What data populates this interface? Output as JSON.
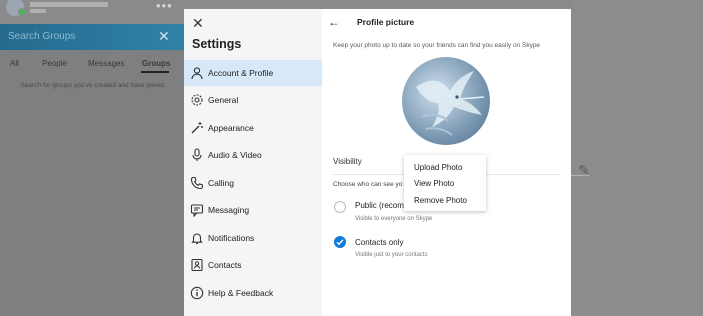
{
  "background": {
    "search_placeholder": "Search Groups",
    "filters": [
      "All",
      "People",
      "Messages",
      "Groups"
    ],
    "groups_hint": "Search for groups you've created and have joined."
  },
  "settings": {
    "title": "Settings",
    "nav_items": [
      {
        "label": "Account & Profile",
        "icon": "user-icon",
        "selected": true
      },
      {
        "label": "General",
        "icon": "gear-icon",
        "selected": false
      },
      {
        "label": "Appearance",
        "icon": "wand-icon",
        "selected": false
      },
      {
        "label": "Audio & Video",
        "icon": "microphone-icon",
        "selected": false
      },
      {
        "label": "Calling",
        "icon": "phone-icon",
        "selected": false
      },
      {
        "label": "Messaging",
        "icon": "chat-icon",
        "selected": false
      },
      {
        "label": "Notifications",
        "icon": "bell-icon",
        "selected": false
      },
      {
        "label": "Contacts",
        "icon": "contacts-icon",
        "selected": false
      },
      {
        "label": "Help & Feedback",
        "icon": "info-icon",
        "selected": false
      }
    ]
  },
  "profile": {
    "title": "Profile picture",
    "subtitle": "Keep your photo up to date so your friends can find you easily on Skype",
    "visibility_label": "Visibility",
    "who_can_see": "Choose who can see yo",
    "options": [
      {
        "title": "Public (recom",
        "subtitle": "Visible to everyone on Skype",
        "selected": false
      },
      {
        "title": "Contacts only",
        "subtitle": "Visible just to your contacts",
        "selected": true
      }
    ]
  },
  "photo_menu": [
    "Upload Photo",
    "View Photo",
    "Remove Photo"
  ],
  "colors": {
    "accent": "#0f7ad9",
    "selected_nav": "#d7e8f8"
  }
}
